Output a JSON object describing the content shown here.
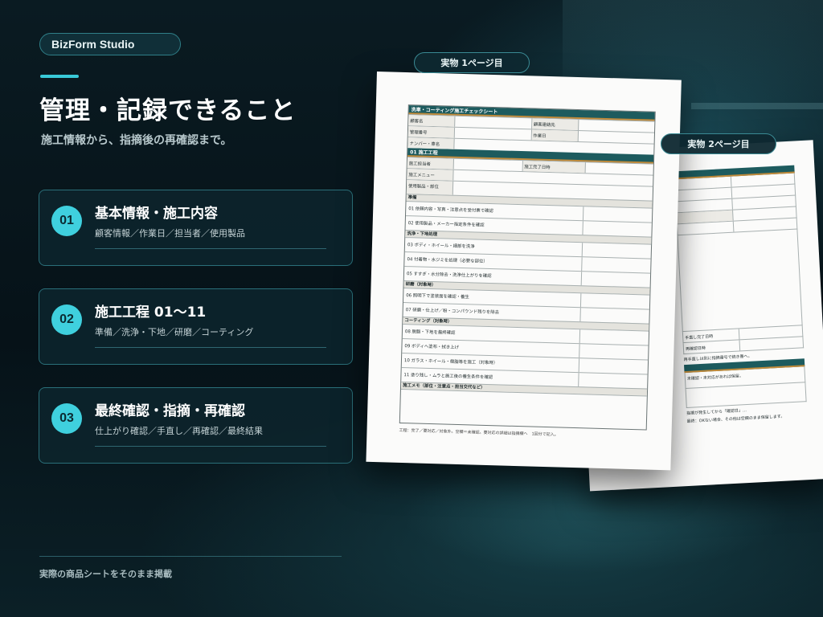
{
  "brand": "BizForm Studio",
  "page_title": "管理・記録できること",
  "page_subtitle": "施工情報から、指摘後の再確認まで。",
  "features": [
    {
      "num": "01",
      "title": "基本情報・施工内容",
      "desc": "顧客情報／作業日／担当者／使用製品"
    },
    {
      "num": "02",
      "title": "施工工程 01〜11",
      "desc": "準備／洗浄・下地／研磨／コーティング"
    },
    {
      "num": "03",
      "title": "最終確認・指摘・再確認",
      "desc": "仕上がり確認／手直し／再確認／最終結果"
    }
  ],
  "footer_note": "実際の商品シートをそのまま掲載",
  "tags": {
    "page1": "実物 1ページ目",
    "page2": "実物 2ページ目"
  },
  "doc1": {
    "header": "洗車・コーティング施工チェックシート",
    "info_rows": [
      [
        "顧客名",
        "顧客連絡先"
      ],
      [
        "管理番号",
        "作業日"
      ]
    ],
    "plate_label": "ナンバー・車名",
    "section_process": "01 施工工程",
    "staff_label": "施工担当者",
    "finish_label": "施工完了日時",
    "menu_label": "施工メニュー",
    "products_label": "使用製品・部位",
    "groups": [
      {
        "name": "準備",
        "items": [
          "01 依頼内容・写真・注意点を受付票で確認",
          "02 使用製品・メーカー指定条件を確認"
        ]
      },
      {
        "name": "洗浄・下地処理",
        "items": [
          "03 ボディ・ホイール・細部を洗浄",
          "04 付着物・水ジミを処理（必要な部位）",
          "05 すすぎ・水分除去・洗浄仕上がりを確認"
        ]
      },
      {
        "name": "研磨（対象時）",
        "items": [
          "06 照明下で塗装面を確認・養生",
          "07 研磨・仕上げ／粉・コンパウンド残りを除去"
        ]
      },
      {
        "name": "コーティング（対象時）",
        "items": [
          "08 脱脂・下地を最終確認",
          "09 ボディへ塗布・拭き上げ",
          "10 ガラス・ホイール・樹脂等を施工（対象時）",
          "11 塗り残し・ムラと施工後の養生条件を確認"
        ]
      }
    ],
    "memo_label": "施工メモ（部位・注意点・担当交代など）",
    "note": "工程：完了／要対応／対象外。空欄＝未確認。要対応の詳細は指摘欄へ　1回分で記入。"
  },
  "doc2": {
    "labels": [
      "手直し完了日時",
      "再確認日時"
    ],
    "note1": "再手直しは別に指摘番号で続き番へ。",
    "note2": "未確認・未対応があれば保留。",
    "note3": "指摘が発生してから「確認日」…",
    "note4": "最終：OKない場合、その他は空欄のまま保留します。"
  }
}
